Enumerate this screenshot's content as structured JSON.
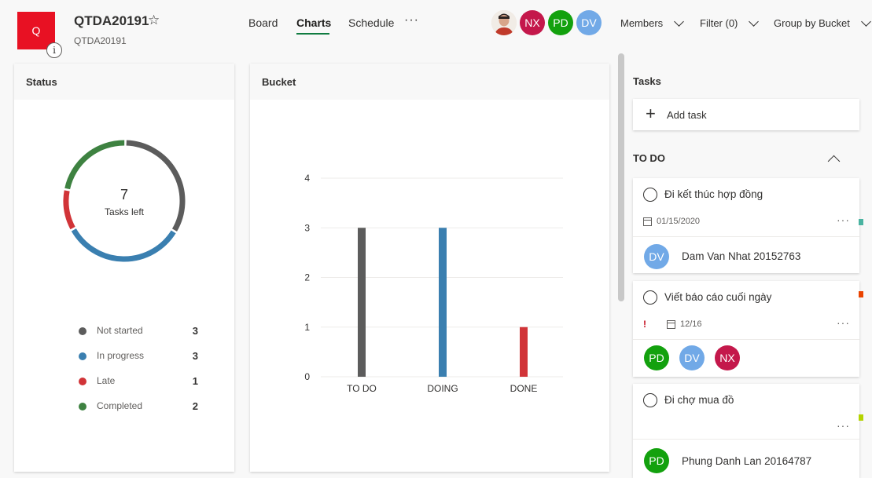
{
  "plan": {
    "logo_letter": "Q",
    "title": "QTDA20191",
    "subtitle": "QTDA20191",
    "info_label": "i"
  },
  "tabs": [
    {
      "label": "Board"
    },
    {
      "label": "Charts"
    },
    {
      "label": "Schedule"
    }
  ],
  "active_tab": "Charts",
  "more_label": "···",
  "members_avatars": [
    {
      "initials": "NX",
      "color": "#c4184b"
    },
    {
      "initials": "PD",
      "color": "#13a10e"
    },
    {
      "initials": "DV",
      "color": "#71a9e7"
    }
  ],
  "header_menus": {
    "members": "Members",
    "filter": "Filter (0)",
    "group_by": "Group by Bucket"
  },
  "status_card": {
    "title": "Status",
    "center_value": "7",
    "center_label": "Tasks left",
    "legend": [
      {
        "label": "Not started",
        "count": "3",
        "color": "#5c5c5c"
      },
      {
        "label": "In progress",
        "count": "3",
        "color": "#3a7fb0"
      },
      {
        "label": "Late",
        "count": "1",
        "color": "#d13438"
      },
      {
        "label": "Completed",
        "count": "2",
        "color": "#3e8241"
      }
    ]
  },
  "bucket_card": {
    "title": "Bucket"
  },
  "chart_data": {
    "type": "bar",
    "categories": [
      "TO DO",
      "DOING",
      "DONE"
    ],
    "values": [
      3,
      3,
      1
    ],
    "colors": [
      "#5c5c5c",
      "#3a7fb0",
      "#d13438"
    ],
    "yticks": [
      "0",
      "1",
      "2",
      "3",
      "4"
    ],
    "ylim": [
      0,
      4
    ],
    "grid": true
  },
  "tasks_panel": {
    "title": "Tasks",
    "add_task_label": "Add task",
    "bucket": "TO DO",
    "tasks": [
      {
        "title": "Đi kết thúc hợp đồng",
        "date": "01/15/2020",
        "assignee_initials": "DV",
        "assignee_name": "Dam Van Nhat 20152763",
        "assignee_color": "#71a9e7",
        "label_color": "#4ab3a1"
      },
      {
        "title": "Viết báo cáo cuối ngày",
        "urgent": "!",
        "date": "12/16",
        "assignees": [
          {
            "initials": "PD",
            "color": "#13a10e"
          },
          {
            "initials": "DV",
            "color": "#71a9e7"
          },
          {
            "initials": "NX",
            "color": "#c4184b"
          }
        ],
        "label_color": "#ea4300"
      },
      {
        "title": "Đi chợ mua đồ",
        "assignee_initials": "PD",
        "assignee_name": "Phung Danh Lan 20164787",
        "assignee_color": "#13a10e",
        "label_color": "#b4d300"
      }
    ]
  }
}
